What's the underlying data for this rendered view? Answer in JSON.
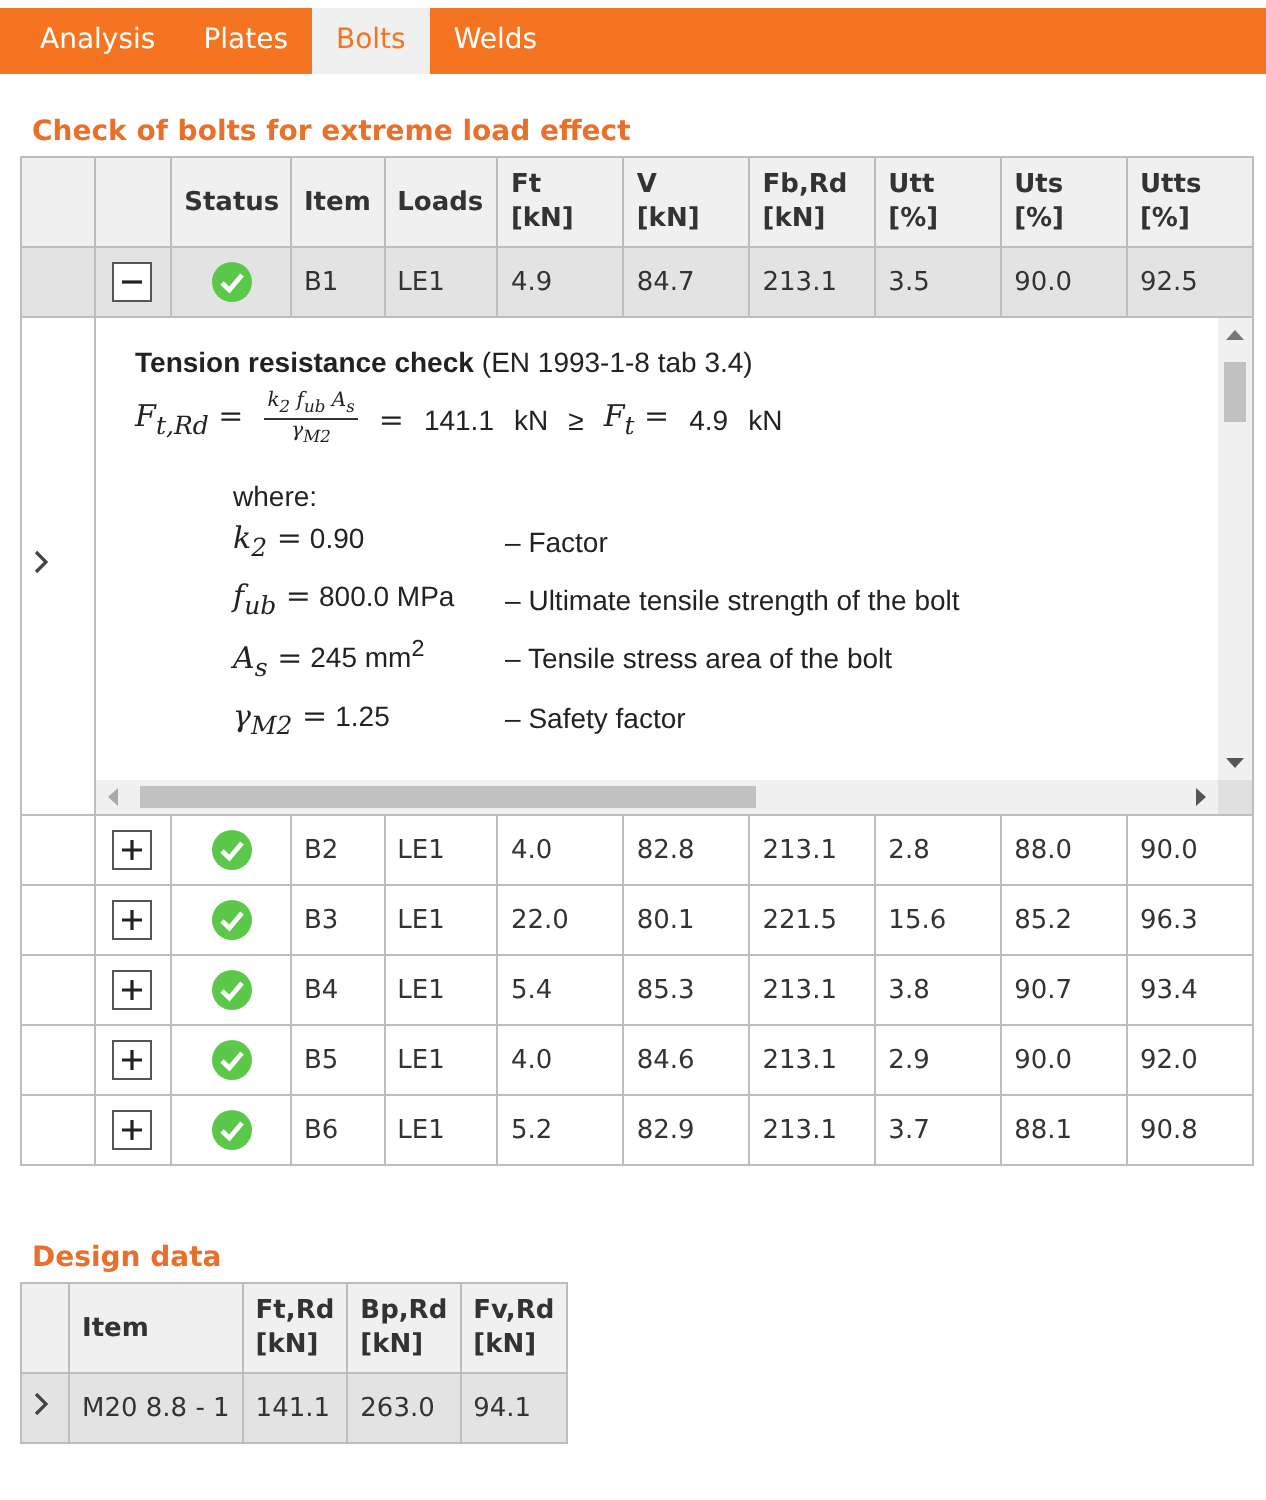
{
  "tabs": [
    {
      "label": "Analysis",
      "selected": false
    },
    {
      "label": "Plates",
      "selected": false
    },
    {
      "label": "Bolts",
      "selected": true
    },
    {
      "label": "Welds",
      "selected": false
    }
  ],
  "bolt_check": {
    "title": "Check of bolts for extreme load effect",
    "status_column": "Status",
    "columns": [
      "Item",
      "Loads",
      "Ft\n[kN]",
      "V\n[kN]",
      "Fb,Rd\n[kN]",
      "Utt\n[%]",
      "Uts\n[%]",
      "Utts\n[%]"
    ],
    "rows": [
      {
        "expanded": true,
        "selected": true,
        "passed": true,
        "cells": [
          "B1",
          "LE1",
          "4.9",
          "84.7",
          "213.1",
          "3.5",
          "90.0",
          "92.5"
        ]
      },
      {
        "expanded": false,
        "selected": false,
        "passed": true,
        "cells": [
          "B2",
          "LE1",
          "4.0",
          "82.8",
          "213.1",
          "2.8",
          "88.0",
          "90.0"
        ]
      },
      {
        "expanded": false,
        "selected": false,
        "passed": true,
        "cells": [
          "B3",
          "LE1",
          "22.0",
          "80.1",
          "221.5",
          "15.6",
          "85.2",
          "96.3"
        ]
      },
      {
        "expanded": false,
        "selected": false,
        "passed": true,
        "cells": [
          "B4",
          "LE1",
          "5.4",
          "85.3",
          "213.1",
          "3.8",
          "90.7",
          "93.4"
        ]
      },
      {
        "expanded": false,
        "selected": false,
        "passed": true,
        "cells": [
          "B5",
          "LE1",
          "4.0",
          "84.6",
          "213.1",
          "2.9",
          "90.0",
          "92.0"
        ]
      },
      {
        "expanded": false,
        "selected": false,
        "passed": true,
        "cells": [
          "B6",
          "LE1",
          "5.2",
          "82.9",
          "213.1",
          "3.7",
          "88.1",
          "90.8"
        ]
      }
    ],
    "detail": {
      "heading": "Tension resistance check",
      "reference": "(EN 1993-1-8 tab 3.4)",
      "formula": {
        "lhs": "F$_{t,Rd}$ =",
        "numerator": "k$_{2}$ f$_{ub}$ A$_{s}$",
        "denominator": "γ$_{M2}$",
        "equals": "=",
        "value": "141.1",
        "unit": "kN",
        "relation": "≥",
        "rhs": "F$_{t}$ =",
        "rhs_value": "4.9",
        "rhs_unit": "kN"
      },
      "where": "where:",
      "definitions": [
        {
          "symbol": "k$_{2}$ =",
          "value": "0.90",
          "description": "– Factor"
        },
        {
          "symbol": "f$_{ub}$ =",
          "value": "800.0 MPa",
          "description": "– Ultimate tensile strength of the bolt"
        },
        {
          "symbol": "A$_{s}$ =",
          "value": "245 mm$^{2}$",
          "description": "– Tensile stress area of the bolt"
        },
        {
          "symbol": "γ$_{M2}$ =",
          "value": "1.25",
          "description": "– Safety factor"
        }
      ]
    }
  },
  "design_data": {
    "title": "Design data",
    "columns": [
      "Item",
      "Ft,Rd\n[kN]",
      "Bp,Rd\n[kN]",
      "Fv,Rd\n[kN]"
    ],
    "rows": [
      {
        "selected": true,
        "cells": [
          "M20 8.8 - 1",
          "141.1",
          "263.0",
          "94.1"
        ]
      }
    ]
  }
}
